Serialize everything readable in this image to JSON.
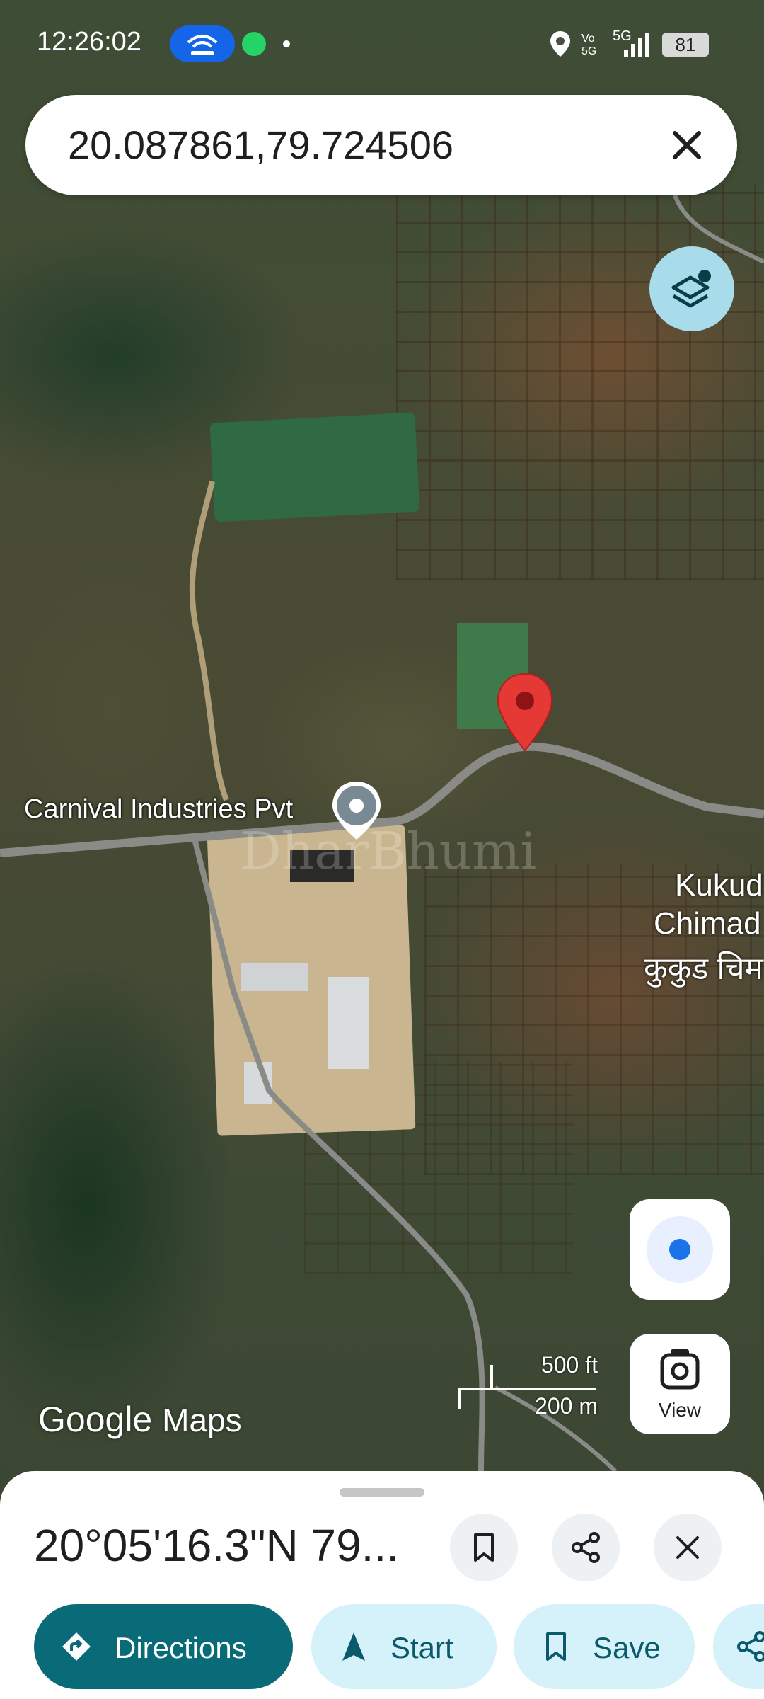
{
  "status_bar": {
    "time": "12:26:02",
    "network": "5G",
    "volte": "Vo 5G",
    "battery": "81"
  },
  "search": {
    "query": "20.087861,79.724506"
  },
  "map": {
    "place_label": "Carnival Industries Pvt",
    "village_line1": "Kukud",
    "village_line2": "Chimad",
    "village_line3": "कुकुड चिम",
    "watermark": "DharBhumi",
    "scale_ft": "500 ft",
    "scale_m": "200 m",
    "attribution_google": "Google",
    "attribution_maps": "Maps"
  },
  "controls": {
    "view_label": "View"
  },
  "sheet": {
    "title": "20°05'16.3\"N 79...",
    "directions_label": "Directions",
    "start_label": "Start",
    "save_label": "Save"
  },
  "colors": {
    "accent": "#0a6b78",
    "chip_bg": "#d5f2fb",
    "pin_red": "#e53935",
    "location_blue": "#1a73e8"
  }
}
